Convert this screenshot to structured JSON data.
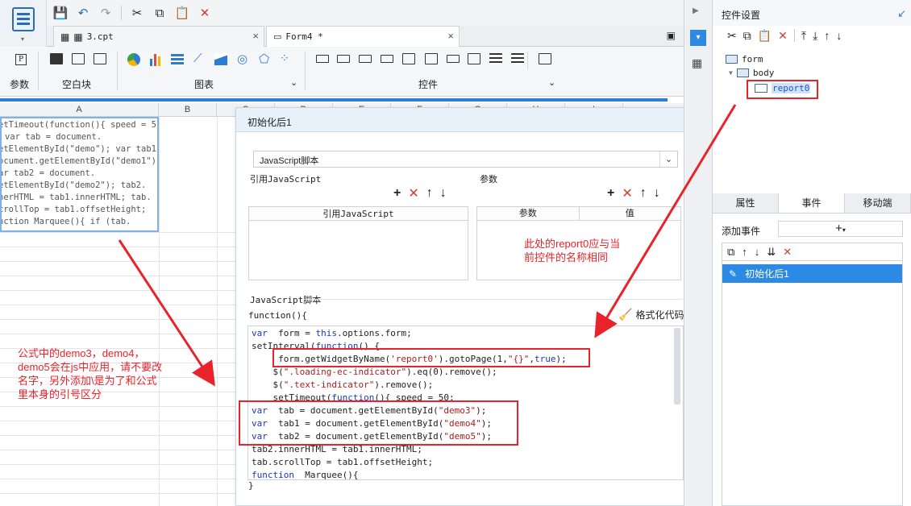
{
  "toolbar": {
    "icons": [
      "save-icon",
      "undo-icon",
      "redo-icon",
      "cut-icon",
      "copy-icon",
      "paste-icon",
      "delete-icon"
    ]
  },
  "tabs": [
    {
      "label": "3.cpt"
    },
    {
      "label": "Form4 *"
    }
  ],
  "ribbon": {
    "groups": [
      {
        "label": "参数"
      },
      {
        "label": "空白块"
      },
      {
        "label": "图表"
      },
      {
        "label": "控件"
      }
    ]
  },
  "sheet": {
    "columns": [
      "A",
      "B",
      "C",
      "D",
      "E",
      "F",
      "G",
      "H",
      "I"
    ],
    "cell_a1_lines": [
      "etTimeout(function(){ speed = 5",
      "var tab = document.",
      "etElementById(\"demo\"); var tab1 =",
      "ocument.getElementById(\"demo1\");",
      "ar tab2 = document.",
      "etElementById(\"demo2\"); tab2.",
      "nerHTML = tab1.innerHTML; tab.",
      "crollTop = tab1.offsetHeight;",
      "nction Marquee(){ if (tab."
    ]
  },
  "dialog": {
    "title": "初始化后1",
    "script_type": "JavaScript脚本",
    "ref_label": "引用JavaScript",
    "param_label": "参数",
    "ref_col": "引用JavaScript",
    "param_col": "参数",
    "value_col": "值",
    "script_label": "JavaScript脚本",
    "func_header": "function(){",
    "format_label": "格式化代码",
    "closing_brace": "}",
    "code_lines": [
      [
        [
          "kw",
          "var"
        ],
        [
          "",
          "  form = "
        ],
        [
          "kw",
          "this"
        ],
        [
          "",
          ".options.form;"
        ]
      ],
      [
        [
          "",
          "setInterval("
        ],
        [
          "kw",
          "function"
        ],
        [
          "",
          "() {"
        ]
      ],
      [
        [
          "",
          "     form.getWidgetByName("
        ],
        [
          "st",
          "'report0'"
        ],
        [
          "",
          ").gotoPage(1,"
        ],
        [
          "st",
          "\"{}\""
        ],
        [
          "",
          ","
        ],
        [
          "kw",
          "true"
        ],
        [
          "",
          ");"
        ]
      ],
      [
        [
          "",
          "    $("
        ],
        [
          "st",
          "\".loading-ec-indicator\""
        ],
        [
          "",
          ").eq(0).remove();"
        ]
      ],
      [
        [
          "",
          "    $("
        ],
        [
          "st",
          "\".text-indicator\""
        ],
        [
          "",
          ").remove();"
        ]
      ],
      [
        [
          "",
          "    setTimeout("
        ],
        [
          "kw",
          "function"
        ],
        [
          "",
          "(){ speed = 50;"
        ]
      ],
      [
        [
          "kw",
          "var"
        ],
        [
          "",
          "  tab = document.getElementById("
        ],
        [
          "st",
          "\"demo3\""
        ],
        [
          "",
          ");"
        ]
      ],
      [
        [
          "kw",
          "var"
        ],
        [
          "",
          "  tab1 = document.getElementById("
        ],
        [
          "st",
          "\"demo4\""
        ],
        [
          "",
          ");"
        ]
      ],
      [
        [
          "kw",
          "var"
        ],
        [
          "",
          "  tab2 = document.getElementById("
        ],
        [
          "st",
          "\"demo5\""
        ],
        [
          "",
          ");"
        ]
      ],
      [
        [
          "",
          "tab2.innerHTML = tab1.innerHTML;"
        ]
      ],
      [
        [
          "",
          "tab.scrollTop = tab1.offsetHeight;"
        ]
      ],
      [
        [
          "kw",
          "function"
        ],
        [
          "",
          "  Marquee(){"
        ]
      ]
    ]
  },
  "right_panel": {
    "title": "控件设置",
    "tree": {
      "root": "form",
      "body": "body",
      "widget": "report0"
    },
    "tabs": [
      "属性",
      "事件",
      "移动端"
    ],
    "active_tab": "事件",
    "add_event_label": "添加事件",
    "event_item": "初始化后1"
  },
  "annotations": {
    "note_right": [
      "此处的report0应与当",
      "前控件的名称相同"
    ],
    "note_left": [
      "公式中的demo3，demo4，",
      "demo5会在js中应用，请不要改",
      "名字，另外添加\\是为了和公式",
      "里本身的引号区分"
    ],
    "color": "#e8232a"
  }
}
